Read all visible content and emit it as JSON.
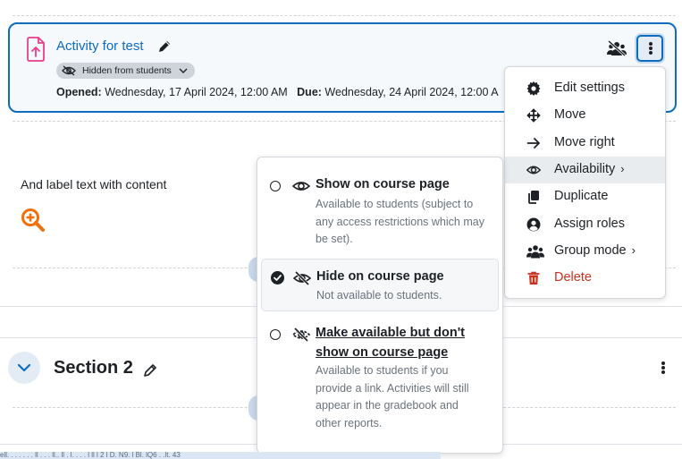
{
  "activity": {
    "title": "Activity for test",
    "badge": "Hidden from students",
    "opened_label": "Opened:",
    "opened_value": "Wednesday, 17 April 2024, 12:00 AM",
    "due_label": "Due:",
    "due_value": "Wednesday, 24 April 2024, 12:00 A",
    "icon": "assignment-upload-icon"
  },
  "label": {
    "text": "And label text with content",
    "icon": "zoom-in-icon"
  },
  "section2": {
    "title": "Section 2"
  },
  "action_menu": {
    "items": [
      {
        "label": "Edit settings",
        "icon": "gear-icon"
      },
      {
        "label": "Move",
        "icon": "move-arrows-icon"
      },
      {
        "label": "Move right",
        "icon": "arrow-right-icon"
      },
      {
        "label": "Availability",
        "icon": "eye-icon",
        "submenu": true
      },
      {
        "label": "Duplicate",
        "icon": "copy-icon"
      },
      {
        "label": "Assign roles",
        "icon": "user-circle-icon"
      },
      {
        "label": "Group mode",
        "icon": "groups-icon",
        "submenu": true
      },
      {
        "label": "Delete",
        "icon": "trash-icon"
      }
    ]
  },
  "availability": {
    "options": [
      {
        "title": "Show on course page",
        "desc": [
          "Available to students (subject to",
          "any access restrictions which may",
          "be set)."
        ],
        "selected": false
      },
      {
        "title": "Hide on course page",
        "desc": [
          "Not available to students."
        ],
        "selected": true
      },
      {
        "title": [
          "Make available but don't",
          "show on course page"
        ],
        "desc": [
          "Available to students if you",
          "provide a link. Activities will still",
          "appear in the gradebook and",
          "other reports."
        ],
        "selected": false
      }
    ]
  },
  "status_url": "ell. .  .  .  .  .  . ll .  .  .  ll..  ll  . l.  .   .  .  l    ll l  2    l   D. N9. l Bl. lQ6   .   .lt.  43",
  "colors": {
    "accent": "#0f6cbf",
    "delete": "#ca3120",
    "activity_icon": "#e83e8c",
    "zoom_icon": "#f0700c"
  }
}
